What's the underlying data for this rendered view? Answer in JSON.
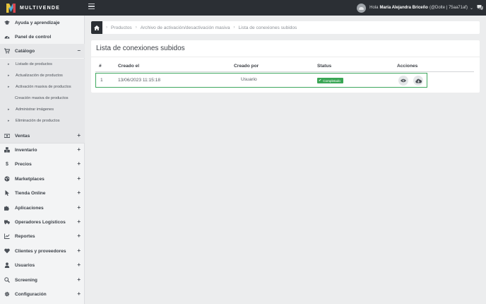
{
  "brand": {
    "name": "MULTIVENDE"
  },
  "user": {
    "greeting": "Hola",
    "name": "María Alejandra Briceño",
    "account": "(@Dolte | 75aa71af)"
  },
  "sidebar": {
    "items": [
      {
        "label": "Ayuda y aprendizaje",
        "icon": "graduation-cap-icon"
      },
      {
        "label": "Panel de control",
        "icon": "dashboard-icon"
      },
      {
        "label": "Catálogo",
        "icon": "cart-icon",
        "toggle": "−"
      },
      {
        "label": "Ventas",
        "icon": "money-icon",
        "toggle": "+"
      },
      {
        "label": "Inventario",
        "icon": "boxes-icon",
        "toggle": "+"
      },
      {
        "label": "Precios",
        "icon": "dollar-icon",
        "toggle": "+"
      },
      {
        "label": "Marketplaces",
        "icon": "globe-icon",
        "toggle": "+"
      },
      {
        "label": "Tienda Online",
        "icon": "pointer-icon",
        "toggle": "+"
      },
      {
        "label": "Aplicaciones",
        "icon": "puzzle-icon",
        "toggle": "+"
      },
      {
        "label": "Operadores Logísticos",
        "icon": "truck-icon",
        "toggle": "+"
      },
      {
        "label": "Reportes",
        "icon": "line-chart-icon",
        "toggle": "+"
      },
      {
        "label": "Clientes y proveedores",
        "icon": "heart-icon",
        "toggle": "+"
      },
      {
        "label": "Usuarios",
        "icon": "user-icon",
        "toggle": "+"
      },
      {
        "label": "Screening",
        "icon": "search-icon",
        "toggle": "+"
      },
      {
        "label": "Configuración",
        "icon": "gear-icon",
        "toggle": "+"
      }
    ],
    "catalog_submenu": [
      "Listado de productos",
      "Actualización de productos",
      "Activación masiva de productos",
      "Creación masiva de productos",
      "Administrar imágenes",
      "Eliminación de productos"
    ]
  },
  "breadcrumb": {
    "items": [
      "Productos",
      "Archivo de activación/desactivación masiva",
      "Lista de conexiones subidos"
    ]
  },
  "panel": {
    "title": "Lista de conexiones subidos",
    "columns": [
      "#",
      "Creado el",
      "Creado por",
      "Status",
      "Acciones"
    ],
    "rows": [
      {
        "index": "1",
        "created_at": "13/06/2023 11:15:18",
        "created_by": "Usuario",
        "status": "Completado",
        "actions": [
          "eye-icon",
          "cloud-download-icon"
        ]
      }
    ]
  },
  "colors": {
    "topbar": "#2b2f34",
    "status_success": "#3aa655",
    "row_highlight": "#3fa85f",
    "sidebar_bg": "#f3f4f5"
  }
}
